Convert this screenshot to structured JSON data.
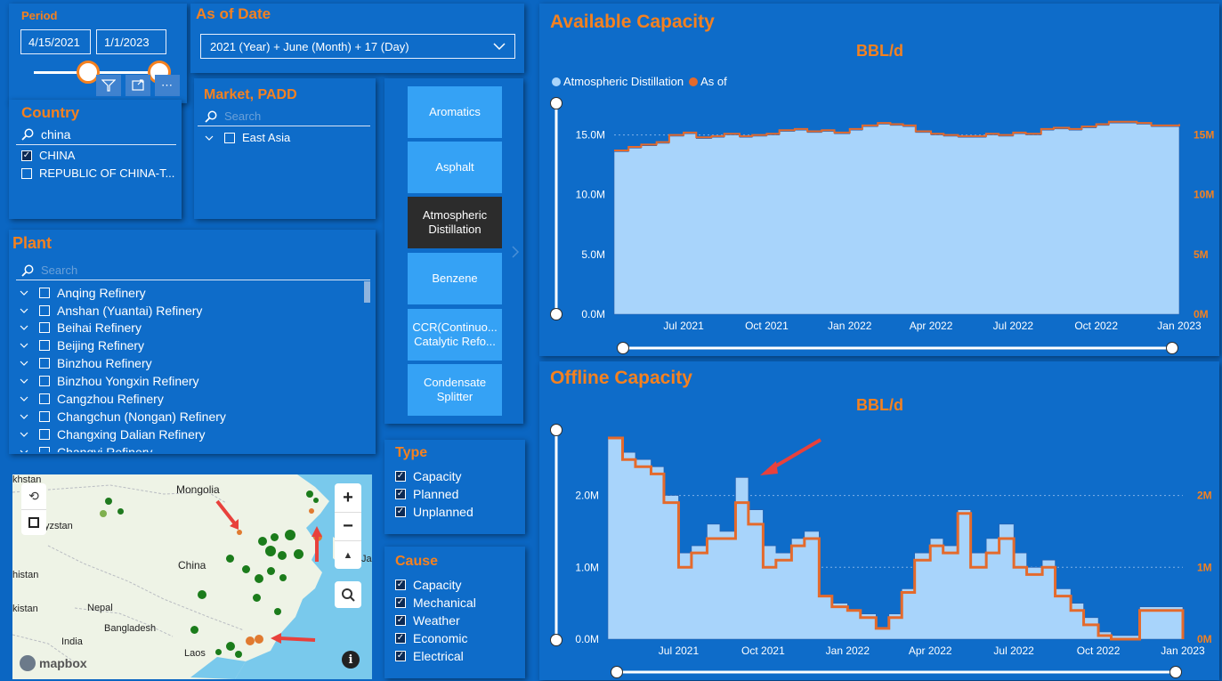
{
  "period": {
    "title": "Period",
    "start": "4/15/2021",
    "end": "1/1/2023"
  },
  "as_of": {
    "title": "As of Date",
    "value": "2021 (Year) + June (Month) + 17 (Day)"
  },
  "country": {
    "title": "Country",
    "search": "china",
    "items": [
      {
        "label": "CHINA",
        "checked": true
      },
      {
        "label": "REPUBLIC OF CHINA-T...",
        "checked": false
      }
    ]
  },
  "market": {
    "title": "Market, PADD",
    "search_placeholder": "Search",
    "items": [
      {
        "label": "East Asia",
        "checked": false
      }
    ]
  },
  "plant": {
    "title": "Plant",
    "search_placeholder": "Search",
    "items": [
      "Anqing Refinery",
      "Anshan (Yuantai) Refinery",
      "Beihai Refinery",
      "Beijing Refinery",
      "Binzhou Refinery",
      "Binzhou Yongxin Refinery",
      "Cangzhou Refinery",
      "Changchun (Nongan) Refinery",
      "Changxing Dalian Refinery",
      "Changyi Refinery"
    ]
  },
  "units": {
    "items": [
      {
        "label": "Aromatics",
        "selected": false
      },
      {
        "label": "Asphalt",
        "selected": false
      },
      {
        "label": "Atmospheric Distillation",
        "selected": true
      },
      {
        "label": "Benzene",
        "selected": false
      },
      {
        "label": "CCR(Continuo... Catalytic Refo...",
        "selected": false
      },
      {
        "label": "Condensate Splitter",
        "selected": false
      }
    ]
  },
  "type": {
    "title": "Type",
    "items": [
      "Capacity",
      "Planned",
      "Unplanned"
    ]
  },
  "cause": {
    "title": "Cause",
    "items": [
      "Capacity",
      "Mechanical",
      "Weather",
      "Economic",
      "Electrical"
    ]
  },
  "map": {
    "labels": [
      "khstan",
      "Mongolia",
      "yzstan",
      "China",
      "histan",
      "Nepal",
      "kistan",
      "Bangladesh",
      "India",
      "Laos",
      "Ja"
    ],
    "brand": "mapbox",
    "zoom_in": "+",
    "zoom_out": "−"
  },
  "colors": {
    "accent": "#f5811f",
    "area_fill": "#a8d4fb",
    "line": "#e46a2c",
    "background": "#0b66c2",
    "arrow": "#e8413c"
  },
  "charts": {
    "available": {
      "title": "Available Capacity",
      "subtitle": "BBL/d",
      "legend": [
        "Atmospheric Distillation",
        "As of"
      ]
    },
    "offline": {
      "title": "Offline Capacity",
      "subtitle": "BBL/d"
    }
  },
  "chart_data": [
    {
      "type": "area",
      "title": "Available Capacity",
      "subtitle": "BBL/d",
      "x_ticks": [
        "Jul 2021",
        "Oct 2021",
        "Jan 2022",
        "Apr 2022",
        "Jul 2022",
        "Oct 2022",
        "Jan 2023"
      ],
      "y_ticks": [
        "0.0M",
        "5.0M",
        "10.0M",
        "15.0M"
      ],
      "y2_ticks": [
        "0M",
        "5M",
        "10M",
        "15M"
      ],
      "ylim": [
        0,
        17.5
      ],
      "grid": true,
      "legend_position": "top-left",
      "series": [
        {
          "name": "Atmospheric Distillation",
          "kind": "area",
          "x": [
            "2021-04-15",
            "2021-05-01",
            "2021-05-15",
            "2021-06-01",
            "2021-06-15",
            "2021-07-01",
            "2021-07-15",
            "2021-08-01",
            "2021-08-15",
            "2021-09-01",
            "2021-09-15",
            "2021-10-01",
            "2021-10-15",
            "2021-11-01",
            "2021-11-15",
            "2021-12-01",
            "2021-12-15",
            "2022-01-01",
            "2022-01-15",
            "2022-02-01",
            "2022-02-15",
            "2022-03-01",
            "2022-03-15",
            "2022-04-01",
            "2022-04-15",
            "2022-05-01",
            "2022-05-15",
            "2022-06-01",
            "2022-06-15",
            "2022-07-01",
            "2022-07-15",
            "2022-08-01",
            "2022-08-15",
            "2022-09-01",
            "2022-09-15",
            "2022-10-01",
            "2022-10-15",
            "2022-11-01",
            "2022-11-15",
            "2022-12-01",
            "2022-12-15",
            "2023-01-01"
          ],
          "values": [
            13.6,
            13.9,
            14.1,
            14.3,
            14.9,
            15.1,
            14.7,
            14.8,
            15.0,
            14.8,
            14.9,
            15.0,
            15.3,
            15.4,
            15.2,
            15.3,
            15.1,
            15.4,
            15.7,
            15.9,
            15.8,
            15.7,
            15.2,
            15.0,
            14.9,
            14.8,
            14.8,
            15.0,
            14.9,
            15.1,
            15.0,
            15.4,
            15.5,
            15.4,
            15.6,
            15.8,
            16.0,
            16.0,
            15.9,
            15.7,
            15.7,
            15.8
          ]
        },
        {
          "name": "As of",
          "kind": "line",
          "x": [
            "2021-04-15",
            "2021-05-01",
            "2021-05-15",
            "2021-06-01",
            "2021-06-15",
            "2021-07-01",
            "2021-07-15",
            "2021-08-01",
            "2021-08-15",
            "2021-09-01",
            "2021-09-15",
            "2021-10-01",
            "2021-10-15",
            "2021-11-01",
            "2021-11-15",
            "2021-12-01",
            "2021-12-15",
            "2022-01-01",
            "2022-01-15",
            "2022-02-01",
            "2022-02-15",
            "2022-03-01",
            "2022-03-15",
            "2022-04-01",
            "2022-04-15",
            "2022-05-01",
            "2022-05-15",
            "2022-06-01",
            "2022-06-15",
            "2022-07-01",
            "2022-07-15",
            "2022-08-01",
            "2022-08-15",
            "2022-09-01",
            "2022-09-15",
            "2022-10-01",
            "2022-10-15",
            "2022-11-01",
            "2022-11-15",
            "2022-12-01",
            "2022-12-15",
            "2023-01-01"
          ],
          "values": [
            13.7,
            14.0,
            14.2,
            14.4,
            15.0,
            15.2,
            14.8,
            14.9,
            15.1,
            14.9,
            15.0,
            15.1,
            15.4,
            15.5,
            15.3,
            15.4,
            15.2,
            15.5,
            15.8,
            16.0,
            15.9,
            15.8,
            15.3,
            15.1,
            15.0,
            14.9,
            14.9,
            15.1,
            15.0,
            15.2,
            15.1,
            15.5,
            15.6,
            15.5,
            15.7,
            15.9,
            16.1,
            16.1,
            16.0,
            15.8,
            15.8,
            15.9
          ]
        }
      ]
    },
    {
      "type": "area",
      "title": "Offline Capacity",
      "subtitle": "BBL/d",
      "x_ticks": [
        "Jul 2021",
        "Oct 2021",
        "Jan 2022",
        "Apr 2022",
        "Jul 2022",
        "Oct 2022",
        "Jan 2023"
      ],
      "y_ticks": [
        "0.0M",
        "1.0M",
        "2.0M"
      ],
      "y2_ticks": [
        "0M",
        "1M",
        "2M"
      ],
      "ylim": [
        0,
        2.8
      ],
      "grid": true,
      "series": [
        {
          "name": "Atmospheric Distillation",
          "kind": "area",
          "x": [
            "2021-04-15",
            "2021-05-01",
            "2021-05-15",
            "2021-06-01",
            "2021-06-15",
            "2021-07-01",
            "2021-07-15",
            "2021-08-01",
            "2021-08-15",
            "2021-09-01",
            "2021-09-15",
            "2021-10-01",
            "2021-10-15",
            "2021-11-01",
            "2021-11-15",
            "2021-12-01",
            "2021-12-15",
            "2022-01-01",
            "2022-01-15",
            "2022-02-01",
            "2022-02-15",
            "2022-03-01",
            "2022-03-15",
            "2022-04-01",
            "2022-04-15",
            "2022-05-01",
            "2022-05-15",
            "2022-06-01",
            "2022-06-15",
            "2022-07-01",
            "2022-07-15",
            "2022-08-01",
            "2022-08-15",
            "2022-09-01",
            "2022-09-15",
            "2022-10-01",
            "2022-10-15",
            "2022-11-01",
            "2022-11-15",
            "2022-12-01",
            "2022-12-15",
            "2023-01-01"
          ],
          "values": [
            2.8,
            2.6,
            2.5,
            2.4,
            2.0,
            1.2,
            1.3,
            1.6,
            1.5,
            2.25,
            1.8,
            1.3,
            1.2,
            1.4,
            1.5,
            0.6,
            0.5,
            0.4,
            0.35,
            0.15,
            0.35,
            0.7,
            1.2,
            1.4,
            1.3,
            1.8,
            1.2,
            1.4,
            1.6,
            1.2,
            1.0,
            1.1,
            0.7,
            0.5,
            0.3,
            0.1,
            0.05,
            0.05,
            0.45,
            0.45,
            0.45,
            0.0
          ]
        },
        {
          "name": "As of",
          "kind": "line",
          "x": [
            "2021-04-15",
            "2021-05-01",
            "2021-05-15",
            "2021-06-01",
            "2021-06-15",
            "2021-07-01",
            "2021-07-15",
            "2021-08-01",
            "2021-08-15",
            "2021-09-01",
            "2021-09-15",
            "2021-10-01",
            "2021-10-15",
            "2021-11-01",
            "2021-11-15",
            "2021-12-01",
            "2021-12-15",
            "2022-01-01",
            "2022-01-15",
            "2022-02-01",
            "2022-02-15",
            "2022-03-01",
            "2022-03-15",
            "2022-04-01",
            "2022-04-15",
            "2022-05-01",
            "2022-05-15",
            "2022-06-01",
            "2022-06-15",
            "2022-07-01",
            "2022-07-15",
            "2022-08-01",
            "2022-08-15",
            "2022-09-01",
            "2022-09-15",
            "2022-10-01",
            "2022-10-15",
            "2022-11-01",
            "2022-11-15",
            "2022-12-01",
            "2022-12-15",
            "2023-01-01"
          ],
          "values": [
            2.8,
            2.5,
            2.4,
            2.3,
            1.9,
            1.0,
            1.2,
            1.4,
            1.4,
            1.9,
            1.6,
            1.0,
            1.1,
            1.3,
            1.4,
            0.6,
            0.45,
            0.4,
            0.3,
            0.15,
            0.3,
            0.65,
            1.1,
            1.3,
            1.2,
            1.75,
            1.0,
            1.2,
            1.4,
            1.0,
            0.9,
            1.0,
            0.6,
            0.4,
            0.2,
            0.05,
            0.0,
            0.0,
            0.4,
            0.4,
            0.4,
            0.0
          ]
        }
      ]
    }
  ]
}
